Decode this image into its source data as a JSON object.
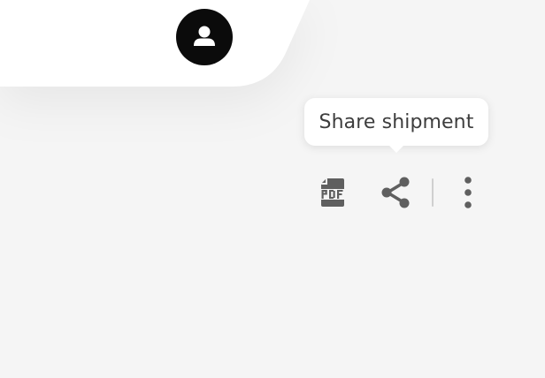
{
  "app": {
    "colors": {
      "background": "#f5f5f5",
      "card": "#ffffff",
      "icon": "#5f5f5f",
      "avatar_bg": "#0b0b0b"
    }
  },
  "header": {
    "avatar_icon": "user-icon"
  },
  "tooltip": {
    "text": "Share shipment"
  },
  "toolbar": {
    "pdf_icon": "pdf-icon",
    "share_icon": "share-icon",
    "more_icon": "more-vertical-icon"
  }
}
